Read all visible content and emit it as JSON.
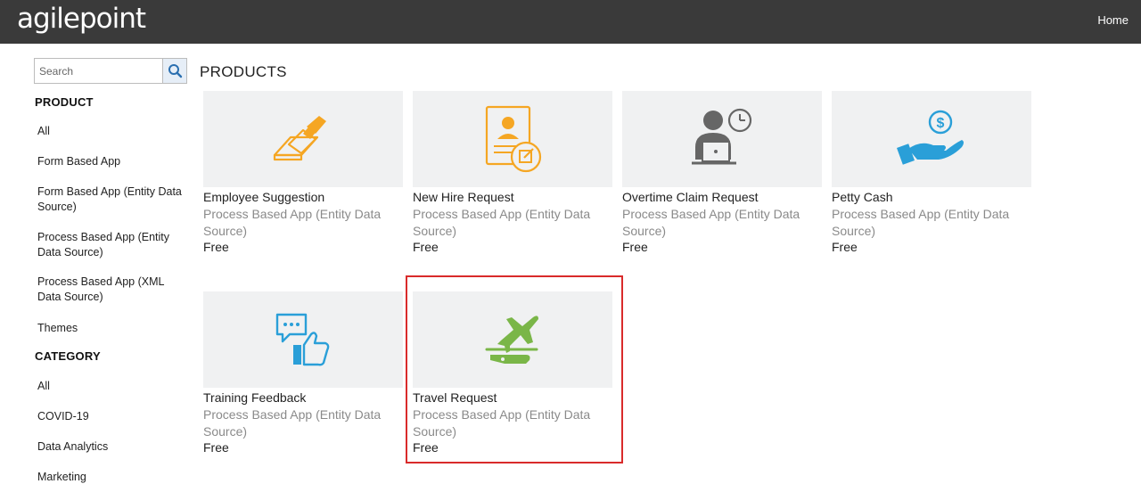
{
  "header": {
    "logo_text": "agilepoint",
    "home_label": "Home"
  },
  "sidebar": {
    "search_placeholder": "Search",
    "product_heading": "PRODUCT",
    "product_items": [
      "All",
      "Form Based App",
      "Form Based App (Entity Data Source)",
      "Process Based App (Entity Data Source)",
      "Process Based App (XML Data Source)",
      "Themes"
    ],
    "category_heading": "CATEGORY",
    "category_items": [
      "All",
      "COVID-19",
      "Data Analytics",
      "Marketing"
    ]
  },
  "main": {
    "title": "PRODUCTS",
    "products": [
      {
        "title": "Employee Suggestion",
        "type": "Process Based App (Entity Data Source)",
        "price": "Free",
        "icon": "vote-icon",
        "icon_color": "#f5a623"
      },
      {
        "title": "New Hire Request",
        "type": "Process Based App (Entity Data Source)",
        "price": "Free",
        "icon": "new-hire-icon",
        "icon_color": "#f5a623"
      },
      {
        "title": "Overtime Claim Request",
        "type": "Process Based App (Entity Data Source)",
        "price": "Free",
        "icon": "overtime-icon",
        "icon_color": "#666666"
      },
      {
        "title": "Petty Cash",
        "type": "Process Based App (Entity Data Source)",
        "price": "Free",
        "icon": "petty-cash-icon",
        "icon_color": "#2a9fd8"
      },
      {
        "title": "Training Feedback",
        "type": "Process Based App (Entity Data Source)",
        "price": "Free",
        "icon": "feedback-icon",
        "icon_color": "#2a9fd8"
      },
      {
        "title": "Travel Request",
        "type": "Process Based App (Entity Data Source)",
        "price": "Free",
        "icon": "travel-icon",
        "icon_color": "#7ab648"
      }
    ]
  },
  "colors": {
    "header_bg": "#3a3a3a",
    "highlight": "#d92b2b",
    "thumb_bg": "#f0f1f2",
    "subtext": "#8a8a8a"
  }
}
